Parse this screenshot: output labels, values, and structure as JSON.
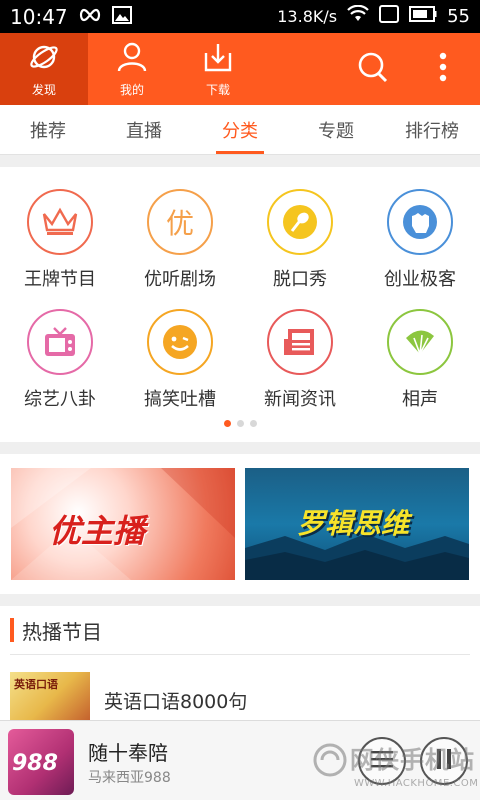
{
  "status_bar": {
    "time": "10:47",
    "network_speed": "13.8K/s",
    "battery": "55"
  },
  "header": {
    "nav": [
      {
        "label": "发现",
        "icon": "planet-icon"
      },
      {
        "label": "我的",
        "icon": "user-icon"
      },
      {
        "label": "下载",
        "icon": "download-icon"
      }
    ],
    "actions": [
      "search-icon",
      "more-vert-icon"
    ],
    "accent_color": "#ff5a1f"
  },
  "tabs": [
    {
      "label": "推荐",
      "active": false
    },
    {
      "label": "直播",
      "active": false
    },
    {
      "label": "分类",
      "active": true
    },
    {
      "label": "专题",
      "active": false
    },
    {
      "label": "排行榜",
      "active": false
    }
  ],
  "categories": [
    {
      "label": "王牌节目",
      "icon": "crown-icon",
      "color": "#f06a4f"
    },
    {
      "label": "优听剧场",
      "icon": "you-char-icon",
      "color": "#f5a04a"
    },
    {
      "label": "脱口秀",
      "icon": "microphone-icon",
      "color": "#f5c51f"
    },
    {
      "label": "创业极客",
      "icon": "fist-icon",
      "color": "#4a90d9"
    },
    {
      "label": "综艺八卦",
      "icon": "tv-icon",
      "color": "#e56aa7"
    },
    {
      "label": "搞笑吐槽",
      "icon": "smiley-icon",
      "color": "#f5a623"
    },
    {
      "label": "新闻资讯",
      "icon": "newspaper-icon",
      "color": "#e85a5a"
    },
    {
      "label": "相声",
      "icon": "fan-icon",
      "color": "#8cc63f"
    }
  ],
  "pager": {
    "pages": 3,
    "current": 0
  },
  "banners": [
    {
      "text": "优主播"
    },
    {
      "text": "罗辑思维"
    }
  ],
  "hot": {
    "title": "热播节目",
    "items": [
      {
        "title": "英语口语8000句",
        "thumb_text": "英语口语"
      }
    ]
  },
  "player": {
    "title": "随十奉陪",
    "subtitle": "马来西亚988",
    "cover_text": "988"
  },
  "watermark": {
    "main": "网侠手机站",
    "sub": "WWW.HACKHOME.COM"
  }
}
